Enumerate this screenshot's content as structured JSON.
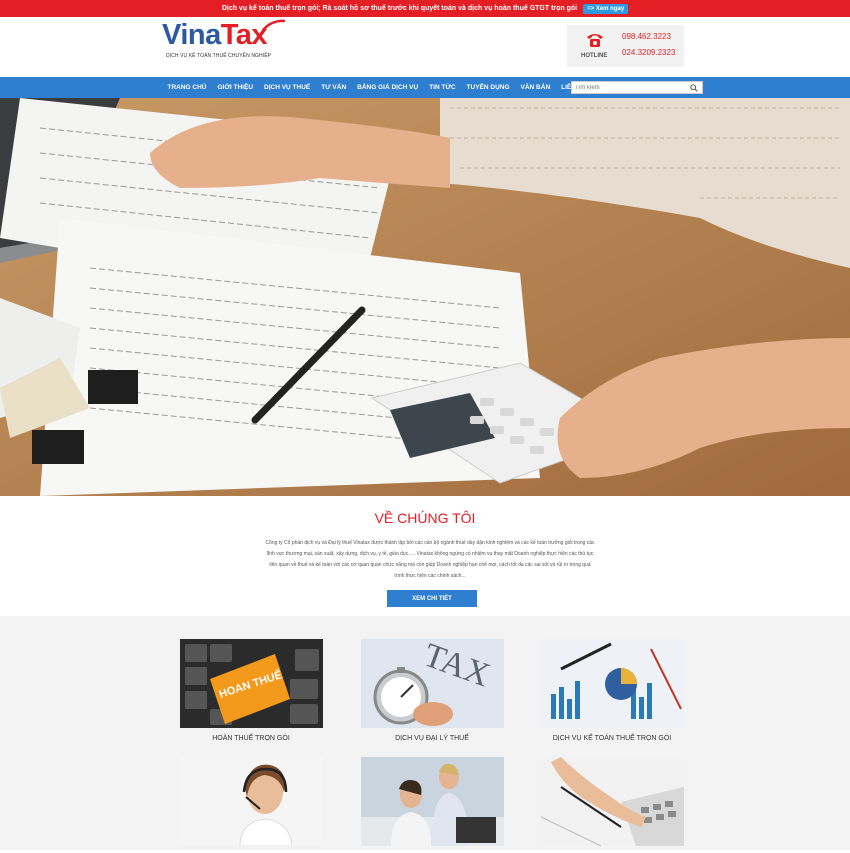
{
  "topbar": {
    "text": "Dịch vụ kế toán thuế trọn gói; Rà soát hồ sơ thuế trước khi quyết toán và dịch vụ hoàn thuế GTGT trọn gói",
    "button_label": "=> Xem ngay"
  },
  "header": {
    "logo_vina": "Vina",
    "logo_tax": "Tax",
    "tagline": "DỊCH VỤ KẾ TOÁN THUẾ CHUYÊN NGHIỆP",
    "hotline_label": "HOTLINE",
    "hotline_1": "098.462.3223",
    "hotline_2": "024.3209.2323"
  },
  "nav": {
    "items": [
      "TRANG CHỦ",
      "GIỚI THIỆU",
      "DỊCH VỤ THUẾ",
      "TƯ VẤN",
      "BẢNG GIÁ DỊCH VỤ",
      "TIN TỨC",
      "TUYỂN DỤNG",
      "VĂN BẢN",
      "LIÊN HỆ"
    ],
    "search_placeholder": "Tìm kiếm"
  },
  "about": {
    "title": "VỀ CHÚNG TÔI",
    "text": "Công ty Cổ phần dịch vụ và Đại lý thuế Vinatax được thành lập bởi các cán bộ ngành thuế dày dặn kinh nghiệm và các kế toán trưởng giỏi trong các lĩnh vực thương mại, sản xuất, xây dựng, dịch vụ, y tế, giáo dục..... Vinatax không ngừng có nhiệm vụ thay mặt Doanh nghiệp thực hiện các thủ tục liên quan về thuế và kế toán với các cơ quan quan chức năng mà còn giúp Doanh nghiệp hạn chế mọi, cách tốt đa các sai sót và rủi ro trong quá trình thực hiện các chính sách...",
    "button_label": "XEM CHI TIẾT"
  },
  "services": [
    {
      "caption": "HOÀN THUẾ TRỌN GÓI",
      "image_text": "HOAN THUẾ"
    },
    {
      "caption": "DỊCH VỤ ĐẠI LÝ THUẾ",
      "image_text": "TAX"
    },
    {
      "caption": "DỊCH VỤ KẾ TOÁN THUẾ TRỌN GÓI",
      "image_text": ""
    },
    {
      "caption": "",
      "image_text": ""
    },
    {
      "caption": "",
      "image_text": ""
    },
    {
      "caption": "",
      "image_text": ""
    }
  ],
  "colors": {
    "brand_red": "#e31e24",
    "brand_blue": "#2f7fd1",
    "logo_blue": "#2c5aa0"
  }
}
